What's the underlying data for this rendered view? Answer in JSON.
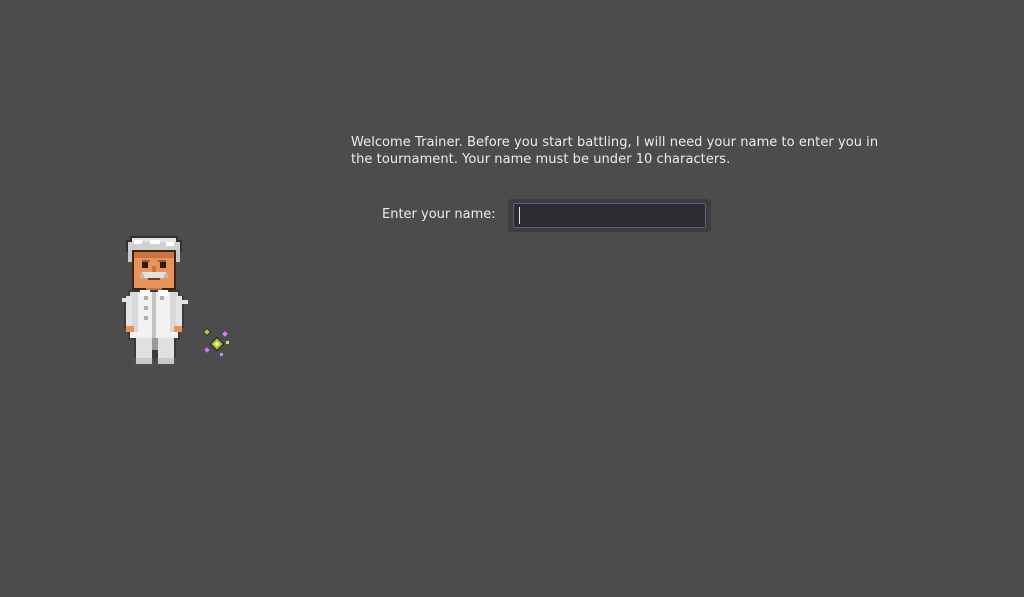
{
  "dialog": {
    "welcome_text": "Welcome Trainer. Before you start battling, I will need your name to enter you in the tournament. Your name must be under 10 characters."
  },
  "name_entry": {
    "label": "Enter your name:",
    "value": "",
    "max_length": 10
  },
  "scene": {
    "background_color": "#4c4c4c",
    "character_icon": "professor-sprite-icon",
    "effect_icon": "sparkle-icon"
  }
}
